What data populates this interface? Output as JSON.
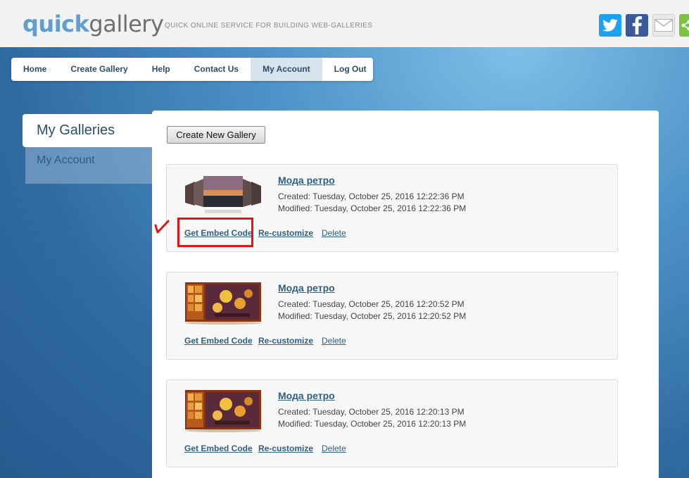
{
  "header": {
    "logo_part1": "quick",
    "logo_part2": "gallery",
    "tagline": "QUICK ONLINE SERVICE FOR BUILDING WEB-GALLERIES",
    "social_icons": [
      "twitter-icon",
      "facebook-icon",
      "email-icon",
      "share-icon"
    ]
  },
  "nav": {
    "items": [
      {
        "label": "Home"
      },
      {
        "label": "Create Gallery"
      },
      {
        "label": "Help"
      },
      {
        "label": "Contact Us"
      },
      {
        "label": "My Account",
        "active": true
      },
      {
        "label": "Log Out"
      }
    ]
  },
  "sidebar": {
    "items": [
      {
        "label": "My Galleries",
        "active": true
      },
      {
        "label": "My Account"
      }
    ]
  },
  "main": {
    "create_button": "Create New Gallery",
    "galleries": [
      {
        "title": "Мода ретро",
        "created": "Created: Tuesday, October 25, 2016 12:22:36 PM",
        "modified": "Modified: Tuesday, October 25, 2016 12:22:36 PM",
        "actions": [
          "Get Embed Code",
          "Re-customize",
          "Delete"
        ]
      },
      {
        "title": "Мода ретро",
        "created": "Created: Tuesday, October 25, 2016 12:20:52 PM",
        "modified": "Modified: Tuesday, October 25, 2016 12:20:52 PM",
        "actions": [
          "Get Embed Code",
          "Re-customize",
          "Delete"
        ]
      },
      {
        "title": "Мода ретро",
        "created": "Created: Tuesday, October 25, 2016 12:20:13 PM",
        "modified": "Modified: Tuesday, October 25, 2016 12:20:13 PM",
        "actions": [
          "Get Embed Code",
          "Re-customize",
          "Delete"
        ]
      }
    ]
  },
  "colors": {
    "link": "#2e5f86",
    "highlight": "#e01515",
    "nav_active": "#d6e4ee"
  }
}
